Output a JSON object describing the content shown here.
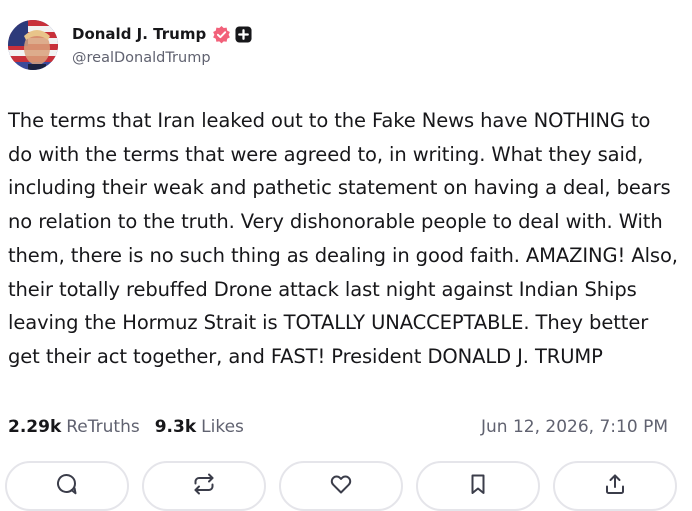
{
  "author": {
    "name": "Donald J. Trump",
    "handle": "@realDonaldTrump",
    "verified_color": "#f2617a"
  },
  "post": {
    "text": "The terms that Iran leaked out to the Fake News have NOTHING to do with the terms that were agreed to, in writing. What they said, including their weak and pathetic statement on having a deal, bears no relation to the truth. Very dishonorable people to deal with. With them, there is no such thing as dealing in good faith. AMAZING! Also, their totally rebuffed Drone attack last night against Indian Ships leaving the Hormuz Strait is TOTALLY UNACCEPTABLE. They better get their act together, and FAST! President DONALD J. TRUMP"
  },
  "stats": {
    "retruths_count": "2.29k",
    "retruths_label": "ReTruths",
    "likes_count": "9.3k",
    "likes_label": "Likes",
    "timestamp": "Jun 12, 2026, 7:10 PM"
  },
  "actions": [
    {
      "icon": "reply-icon"
    },
    {
      "icon": "retruth-icon"
    },
    {
      "icon": "like-icon"
    },
    {
      "icon": "bookmark-icon"
    },
    {
      "icon": "share-icon"
    }
  ]
}
